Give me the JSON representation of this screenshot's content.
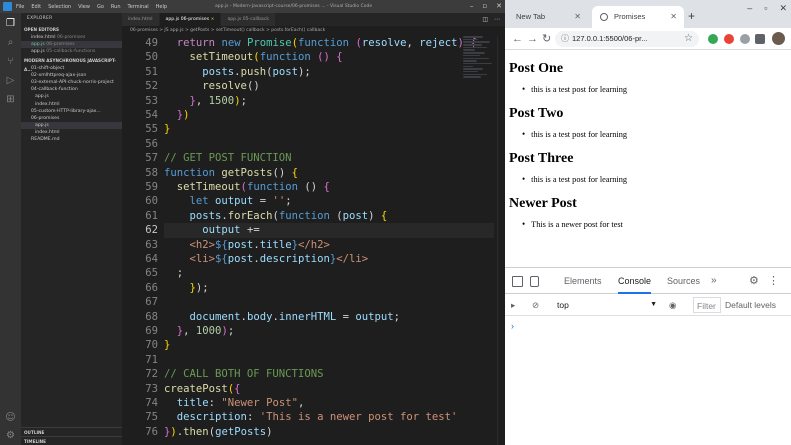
{
  "vscode": {
    "title": "app.js - Modern-Javascript-course/06-promises ... - Visual Studio Code",
    "menu": [
      "File",
      "Edit",
      "Selection",
      "View",
      "Go",
      "Run",
      "Terminal",
      "Help"
    ],
    "sidebar": {
      "title": "EXPLORER",
      "open_editors_label": "OPEN EDITORS",
      "open_editors": [
        {
          "name": "index.html",
          "path": "06-promises"
        },
        {
          "name": "app.js",
          "path": "06-promises"
        },
        {
          "name": "app.js",
          "path": "05-callback-functions"
        }
      ],
      "workspace_label": "MODERN ASYNCHRONOUS JAVASCRIPT-A...",
      "files": [
        {
          "name": "01-shift-object",
          "type": "folder"
        },
        {
          "name": "02-xmlhttpreq-ajax-json",
          "type": "folder"
        },
        {
          "name": "03-external-API-chuck-norris-project",
          "type": "folder"
        },
        {
          "name": "04-callback-function",
          "type": "folder"
        },
        {
          "name": "app.js",
          "type": "file"
        },
        {
          "name": "index.html",
          "type": "file"
        },
        {
          "name": "05-custom-HTTP-library-ajax...",
          "type": "folder"
        },
        {
          "name": "06-promises",
          "type": "folder"
        },
        {
          "name": "app.js",
          "type": "file",
          "selected": true
        },
        {
          "name": "index.html",
          "type": "file"
        },
        {
          "name": "README.md",
          "type": "file"
        }
      ],
      "outline_label": "OUTLINE",
      "timeline_label": "TIMELINE"
    },
    "tabs": [
      {
        "label": "index.html",
        "active": false
      },
      {
        "label": "app.js 06-promises",
        "active": true
      },
      {
        "label": "app.js 05-callback",
        "active": false
      }
    ],
    "breadcrumb": "06-promises > JS app.js > getPosts > setTimeout() callback > posts.forEach() callback",
    "editor": {
      "current_line": 62,
      "line_numbers": [
        "49",
        "50",
        "51",
        "52",
        "53",
        "54",
        "55",
        "56",
        "57",
        "58",
        "59",
        "60",
        "61",
        "62",
        "63",
        "64",
        "65",
        "66",
        "67",
        "68",
        "69",
        "70",
        "71",
        "72",
        "73",
        "74",
        "75",
        "76"
      ]
    }
  },
  "chrome": {
    "tabs": [
      {
        "label": "New Tab",
        "active": false
      },
      {
        "label": "Promises",
        "active": true
      }
    ],
    "url": "127.0.0.1:5500/06-pr...",
    "page": {
      "posts": [
        {
          "title": "Post One",
          "description": "this is a test post for learning"
        },
        {
          "title": "Post Two",
          "description": "this is a test post for learning"
        },
        {
          "title": "Post Three",
          "description": "this is a test post for learning"
        },
        {
          "title": "Newer Post",
          "description": "This is a newer post for test"
        }
      ]
    },
    "devtools": {
      "tabs": [
        "Elements",
        "Console",
        "Sources"
      ],
      "active_tab": "Console",
      "context": "top",
      "filter_placeholder": "Filter",
      "levels": "Default levels"
    }
  },
  "colors": {
    "editor_bg": "#1e1e1e",
    "keyword": "#569cd6",
    "function": "#dcdcaa",
    "string": "#ce9178",
    "comment": "#6a9955",
    "devtools_accent": "#1a73e8"
  }
}
